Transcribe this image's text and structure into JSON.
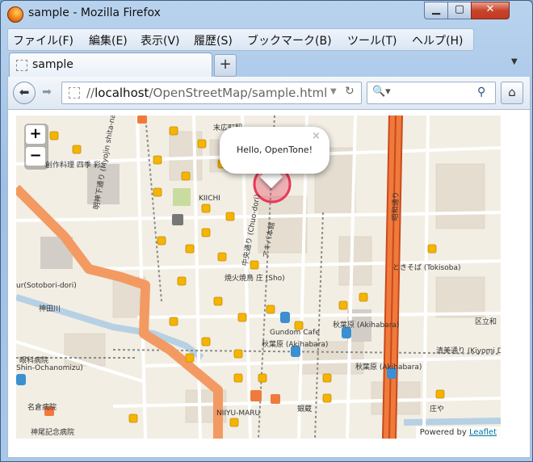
{
  "window": {
    "title": "sample - Mozilla Firefox"
  },
  "menu": [
    {
      "label": "ファイル(F)"
    },
    {
      "label": "編集(E)"
    },
    {
      "label": "表示(V)"
    },
    {
      "label": "履歴(S)"
    },
    {
      "label": "ブックマーク(B)"
    },
    {
      "label": "ツール(T)"
    },
    {
      "label": "ヘルプ(H)"
    }
  ],
  "tab": {
    "label": "sample",
    "new_tab": "+"
  },
  "url": {
    "prefix": "//",
    "host": "localhost",
    "path": "/OpenStreetMap/sample.html"
  },
  "map": {
    "zoom_in": "+",
    "zoom_out": "−",
    "popup_text": "Hello, OpenTone!",
    "popup_close": "×",
    "attribution_prefix": "Powered by ",
    "attribution_link": "Leaflet",
    "labels": [
      "末広町駅",
      "創作料理 四季 彩",
      "KIICHI",
      "明神下通り (Myojin shita-naka dori)",
      "中央通り (Chuo-dori)",
      "アキバ本館",
      "ときそば (Tokisoba)",
      "焼火焼鳥 庄 (Sho)",
      "Gundom Cafe",
      "秋葉原 (Akihabara)",
      "秋葉原 (Akihabara)",
      "秋葉原 (Akihabara)",
      "清美通り (Kiyomi Dori)",
      "眼科病院",
      "Shin-Ochanomizu)",
      "名倉病院",
      "神尾記念病院",
      "NIIYU-MARU",
      "銀蔵",
      "庄や",
      "ur(Sotobori-dori)",
      "神田川",
      "区立和",
      "昭和通り"
    ],
    "colors": {
      "road_major": "#f07a3c",
      "road_primary": "#f39a62",
      "water": "#b6d0e4",
      "marker": "#e8385a",
      "poi": "#f4b400"
    }
  }
}
